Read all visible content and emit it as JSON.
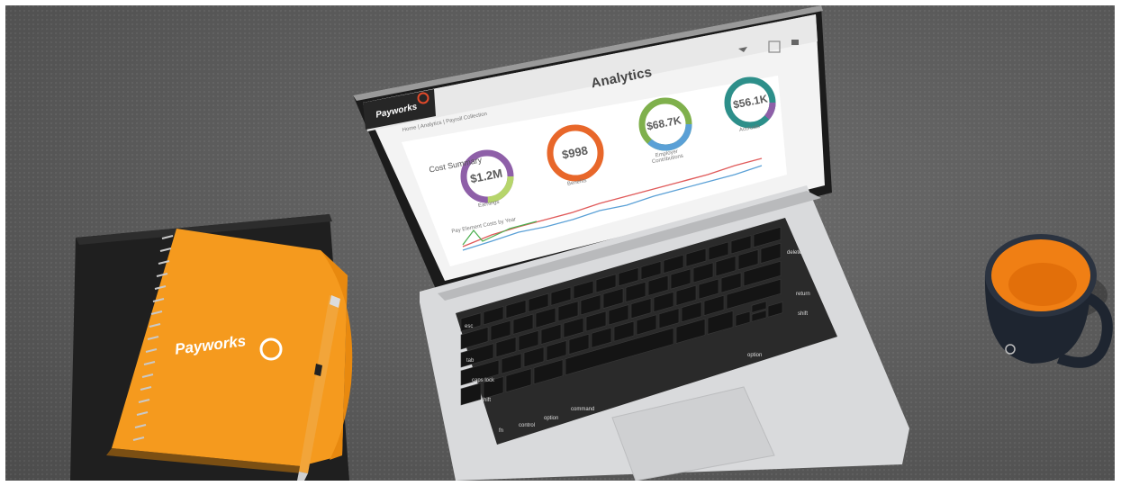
{
  "laptop_screen": {
    "brand": "Payworks",
    "title": "Analytics",
    "breadcrumb": "Home | Analytics | Payroll Collection",
    "section_title": "Cost Summary",
    "donuts": [
      {
        "value": "$1.2M",
        "label": "Earnings",
        "color": "#8e5fa8"
      },
      {
        "value": "$998",
        "label": "Benefits",
        "color": "#e8672a"
      },
      {
        "value": "$68.7K",
        "label": "Employer Contributions",
        "color": "#7fb04c"
      },
      {
        "value": "$56.1K",
        "label": "Accruals",
        "color": "#2d8f8a"
      }
    ],
    "chart_title": "Pay Element Costs by Year"
  },
  "notebook": {
    "brand": "Payworks"
  },
  "keyboard": {
    "keys": [
      "esc",
      "tab",
      "caps lock",
      "shift",
      "fn",
      "control",
      "option",
      "command",
      "return",
      "shift",
      "option",
      "delete"
    ]
  }
}
